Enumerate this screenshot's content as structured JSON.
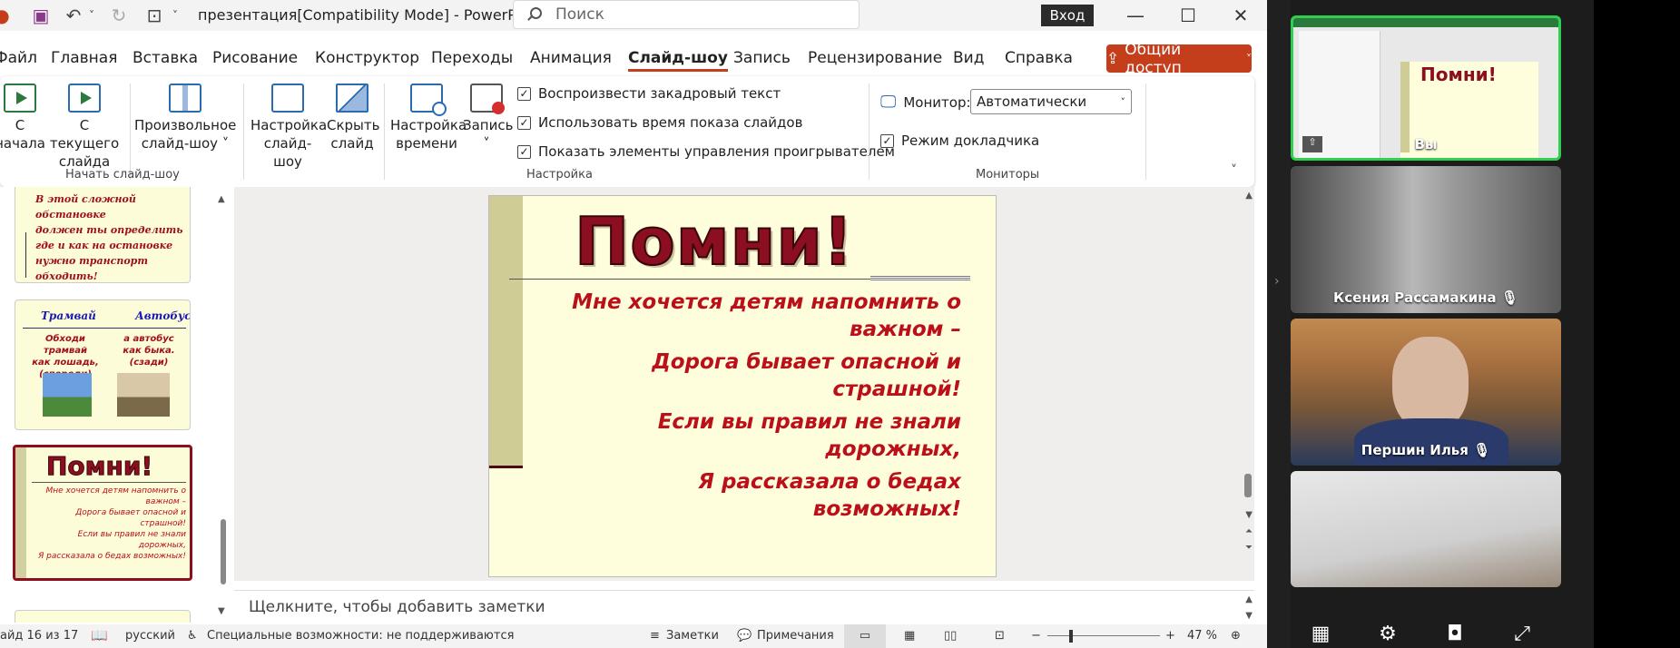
{
  "titlebar": {
    "doc_title": "презентация[Compatibility Mode]  -  PowerP...",
    "search_placeholder": "Поиск",
    "signin_label": "Вход",
    "icons": [
      "save-icon",
      "undo-icon",
      "redo-icon",
      "present-icon"
    ]
  },
  "menu": {
    "tabs": [
      "Файл",
      "Главная",
      "Вставка",
      "Рисование",
      "Конструктор",
      "Переходы",
      "Анимация",
      "Слайд-шоу",
      "Запись",
      "Рецензирование",
      "Вид",
      "Справка"
    ],
    "active_tab": "Слайд-шоу",
    "share_label": "Общий доступ"
  },
  "ribbon": {
    "from_start_l1": "С",
    "from_start_l2": "начала",
    "from_current_l1": "С текущего",
    "from_current_l2": "слайда",
    "custom_l1": "Произвольное",
    "custom_l2": "слайд-шоу ˅",
    "group_start": "Начать слайд-шоу",
    "setup_l1": "Настройка",
    "setup_l2": "слайд-шоу",
    "hide_l1": "Скрыть",
    "hide_l2": "слайд",
    "timing_l1": "Настройка",
    "timing_l2": "времени",
    "record_l1": "Запись",
    "record_l2": "˅",
    "chk_narration": "Воспроизвести закадровый текст",
    "chk_timings": "Использовать время показа слайдов",
    "chk_controls": "Показать элементы управления проигрывателем",
    "group_setup": "Настройка",
    "monitor_label": "Монитор:",
    "monitor_value": "Автоматически",
    "chk_presenter": "Режим докладчика",
    "group_monitors": "Мониторы"
  },
  "thumbnails": {
    "t1_text": [
      "В этой сложной обстановке",
      "должен ты определить",
      "где и как на остановке",
      "нужно транспорт обходить!"
    ],
    "t2_head_left": "Трамвай",
    "t2_head_right": "Автобус",
    "t2_left": [
      "Обходи трамвай",
      "как лошадь,",
      "(спереди)"
    ],
    "t2_right": [
      "а автобус",
      "как быка.",
      "(сзади)"
    ],
    "t3_title": "Помни!",
    "t3_text": [
      "Мне хочется детям напомнить о",
      "важном –",
      "Дорога бывает опасной и",
      "страшной!",
      "Если вы правил не знали",
      "дорожных,",
      "Я рассказала о бедах возможных!"
    ]
  },
  "slide": {
    "title": "Помни!",
    "lines": [
      "Мне хочется детям напомнить о важном –",
      "Дорога бывает опасной и страшной!",
      "Если вы правил не знали дорожных,",
      "Я рассказала о бедах возможных!"
    ]
  },
  "notes": {
    "placeholder": "Щелкните, чтобы добавить заметки"
  },
  "status": {
    "slide_count": "айд 16 из 17",
    "language": "русский",
    "accessibility": "Специальные возможности: не поддерживаются",
    "notes_btn": "Заметки",
    "comments_btn": "Примечания",
    "zoom": "47 %"
  },
  "meeting": {
    "self_label": "Вы",
    "mini_title": "Помни!",
    "participant1": "Ксения Рассамакина",
    "participant2": "Першин Илья"
  }
}
